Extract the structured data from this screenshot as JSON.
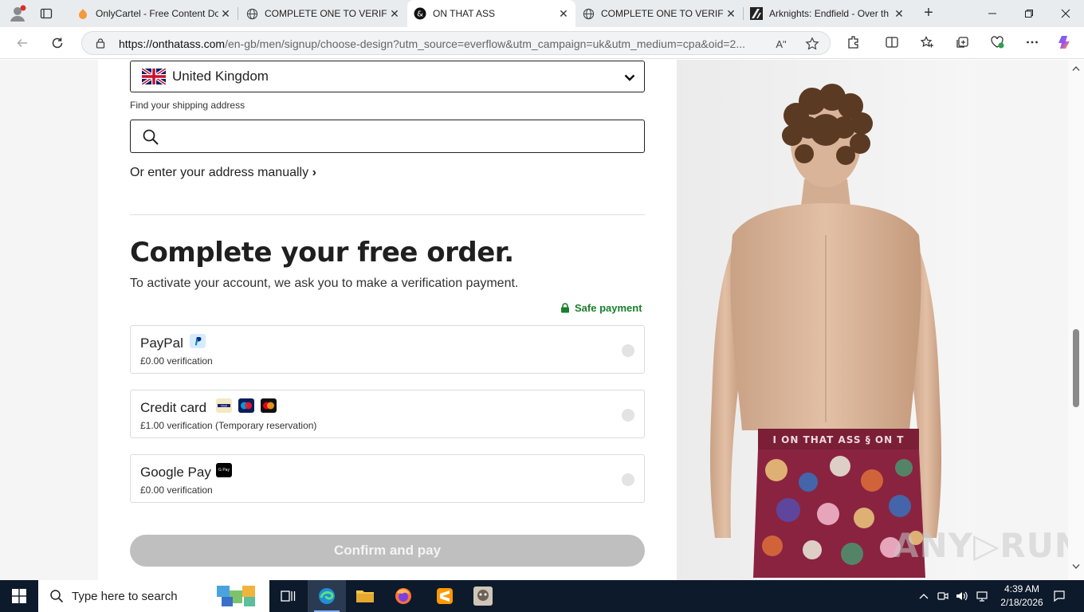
{
  "browser": {
    "tabs": [
      {
        "title": "OnlyCartel - Free Content Do",
        "icon": "onlycartel-favicon",
        "active": false
      },
      {
        "title": "COMPLETE ONE TO VERIFY",
        "icon": "globe-icon",
        "active": false
      },
      {
        "title": "ON THAT ASS",
        "icon": "onthatass-favicon",
        "active": true
      },
      {
        "title": "COMPLETE ONE TO VERIFY",
        "icon": "globe-icon",
        "active": false
      },
      {
        "title": "Arknights: Endfield - Over th",
        "icon": "arknights-favicon",
        "active": false
      }
    ],
    "url_host": "https://onthatass.com",
    "url_path": "/en-gb/men/signup/choose-design?utm_source=everflow&utm_campaign=uk&utm_medium=cpa&oid=2...",
    "read_aloud_label": "Aʺ"
  },
  "page": {
    "country": "United Kingdom",
    "shipping_label": "Find your shipping address",
    "search_value": "",
    "manual_link": "Or enter your address manually",
    "manual_chevron": "›",
    "title": "Complete your free order.",
    "subtitle": "To activate your account, we ask you to make a verification payment.",
    "safe_payment": "Safe payment",
    "payment_options": [
      {
        "name": "PayPal",
        "description": "£0.00 verification",
        "selected": false
      },
      {
        "name": "Credit card",
        "description": "£1.00 verification (Temporary reservation)",
        "selected": false
      },
      {
        "name": "Google Pay",
        "description": "£0.00 verification",
        "selected": false
      }
    ],
    "card_badges": [
      "VISA",
      "maestro",
      "mastercard"
    ],
    "gpay_badge": "G Pay",
    "confirm_label": "Confirm and pay",
    "product_waistband_text": "I ON THAT ASS § ON T"
  },
  "watermark": "ANY▷RUN",
  "taskbar": {
    "search_placeholder": "Type here to search",
    "time": "4:39 AM",
    "date": "2/18/2026"
  },
  "colors": {
    "accent_green": "#1a7f2c",
    "confirm_disabled": "#bfbfbf",
    "taskbar": "#0d1a2b"
  }
}
